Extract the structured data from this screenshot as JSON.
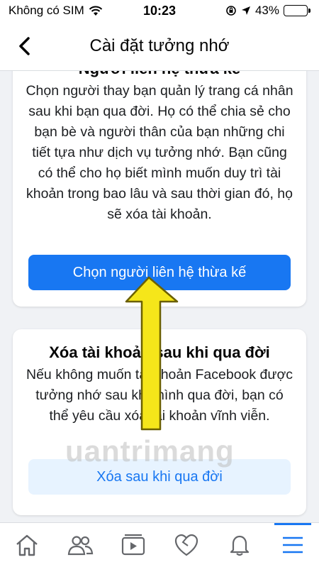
{
  "status_bar": {
    "carrier": "Không có SIM",
    "time": "10:23",
    "battery": "43%",
    "battery_level": 0.43,
    "icons": [
      "wifi-icon",
      "screen-lock-icon",
      "location-icon",
      "battery-icon"
    ]
  },
  "header": {
    "title": "Cài đặt tưởng nhớ",
    "back_icon": "chevron-left-icon"
  },
  "legacy_contact_card": {
    "title": "Người liên hệ thừa kế",
    "description": "Chọn người thay bạn quản lý trang cá nhân sau khi bạn qua đời. Họ có thể chia sẻ cho bạn bè và người thân của bạn những chi tiết tựa như dịch vụ tưởng nhớ. Bạn cũng có thể cho họ biết mình muốn duy trì tài khoản trong bao lâu và sau thời gian đó, họ sẽ xóa tài khoản.",
    "button_label": "Chọn người liên hệ thừa kế"
  },
  "delete_after_death_card": {
    "title": "Xóa tài khoản sau khi qua đời",
    "description": "Nếu không muốn tài khoản Facebook được tưởng nhớ sau khi mình qua đời, bạn có thể yêu cầu xóa tài khoản vĩnh viễn.",
    "button_label": "Xóa sau khi qua đời"
  },
  "watermark": "uantrimang",
  "tab_bar": {
    "tabs": [
      {
        "icon": "home-icon",
        "active": false
      },
      {
        "icon": "friends-icon",
        "active": false
      },
      {
        "icon": "watch-video-icon",
        "active": false
      },
      {
        "icon": "dating-heart-icon",
        "active": false
      },
      {
        "icon": "notifications-bell-icon",
        "active": false
      },
      {
        "icon": "menu-icon",
        "active": true
      }
    ]
  },
  "colors": {
    "brand_blue": "#1877f2",
    "light_blue": "#e7f3ff",
    "background": "#f0f2f5",
    "annotation_arrow": "#f5e61a"
  }
}
